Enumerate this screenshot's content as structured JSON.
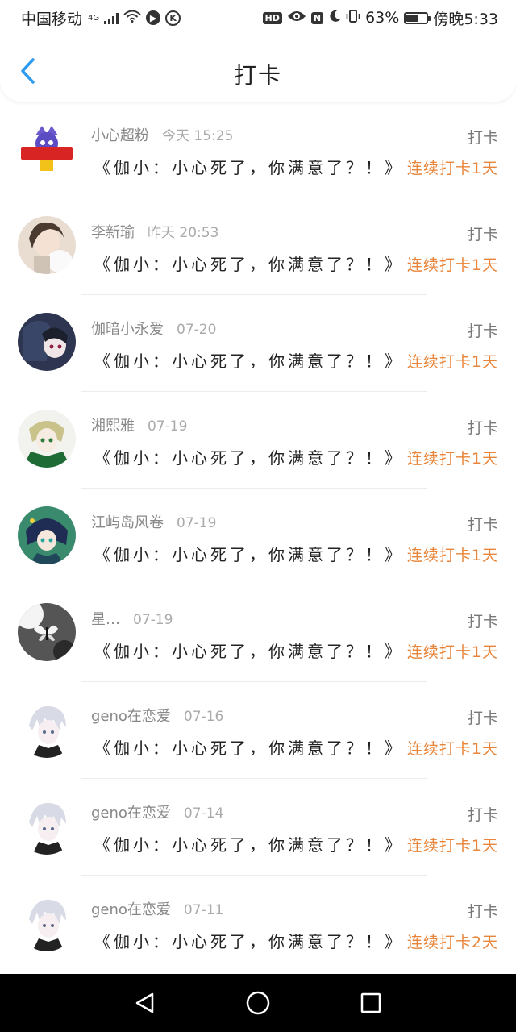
{
  "status_bar": {
    "carrier": "中国移动",
    "network": "4G",
    "nfc": "N",
    "hd": "HD",
    "battery_percent": "63%",
    "battery_level": 0.63,
    "clock": "傍晚5:33"
  },
  "header": {
    "title": "打卡"
  },
  "colors": {
    "accent_blue": "#2f9bf0",
    "streak_orange": "#e8853a"
  },
  "items": [
    {
      "name": "小心超粉",
      "time": "今天 15:25",
      "action": "打卡",
      "content": "《伽小：小心死了，你满意了？！》",
      "streak": "连续打卡1天"
    },
    {
      "name": "李新瑜",
      "time": "昨天 20:53",
      "action": "打卡",
      "content": "《伽小：小心死了，你满意了？！》",
      "streak": "连续打卡1天"
    },
    {
      "name": "伽暗小永爱",
      "time": "07-20",
      "action": "打卡",
      "content": "《伽小：小心死了，你满意了？！》",
      "streak": "连续打卡1天"
    },
    {
      "name": "湘熙雅",
      "time": "07-19",
      "action": "打卡",
      "content": "《伽小：小心死了，你满意了？！》",
      "streak": "连续打卡1天"
    },
    {
      "name": "江屿岛风卷",
      "time": "07-19",
      "action": "打卡",
      "content": "《伽小：小心死了，你满意了？！》",
      "streak": "连续打卡1天"
    },
    {
      "name": "星…",
      "time": "07-19",
      "action": "打卡",
      "content": "《伽小：小心死了，你满意了？！》",
      "streak": "连续打卡1天"
    },
    {
      "name": "geno在恋爱",
      "time": "07-16",
      "action": "打卡",
      "content": "《伽小：小心死了，你满意了？！》",
      "streak": "连续打卡1天"
    },
    {
      "name": "geno在恋爱",
      "time": "07-14",
      "action": "打卡",
      "content": "《伽小：小心死了，你满意了？！》",
      "streak": "连续打卡1天"
    },
    {
      "name": "geno在恋爱",
      "time": "07-11",
      "action": "打卡",
      "content": "《伽小：小心死了，你满意了？！》",
      "streak": "连续打卡2天"
    }
  ]
}
